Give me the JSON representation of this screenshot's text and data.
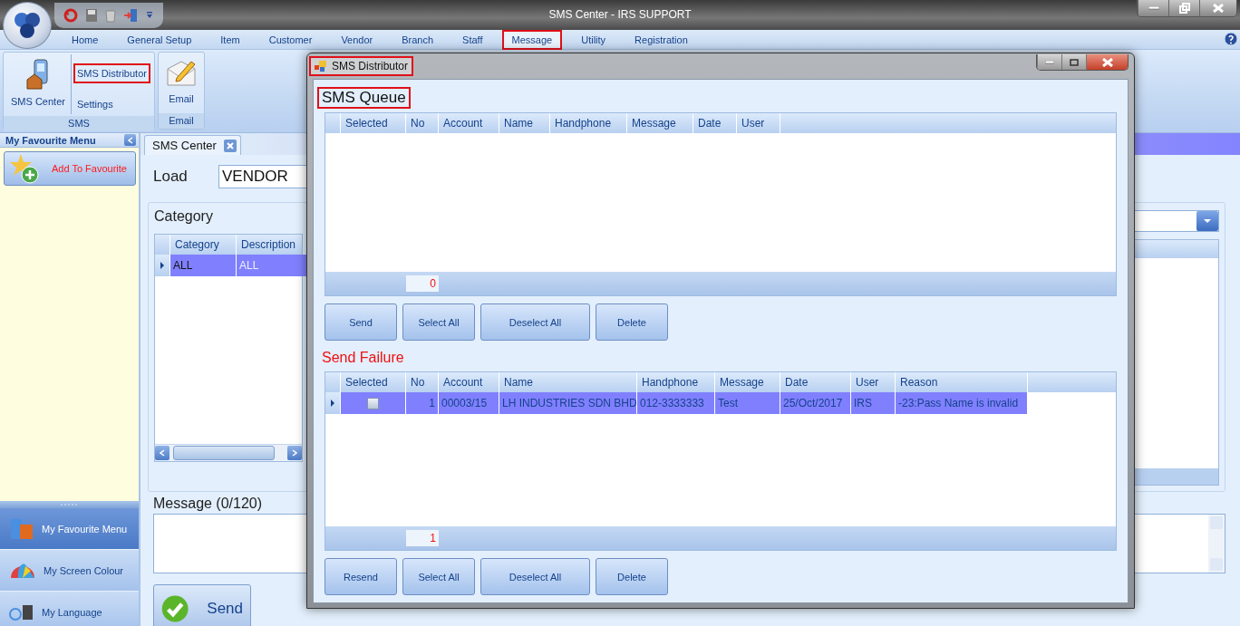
{
  "window": {
    "title": "SMS Center - IRS SUPPORT"
  },
  "menu": [
    {
      "label": "Home",
      "selected": false,
      "highlighted": false
    },
    {
      "label": "General Setup",
      "selected": false,
      "highlighted": false
    },
    {
      "label": "Item",
      "selected": false,
      "highlighted": false
    },
    {
      "label": "Customer",
      "selected": false,
      "highlighted": false
    },
    {
      "label": "Vendor",
      "selected": false,
      "highlighted": false
    },
    {
      "label": "Branch",
      "selected": false,
      "highlighted": false
    },
    {
      "label": "Staff",
      "selected": false,
      "highlighted": false
    },
    {
      "label": "Message",
      "selected": true,
      "highlighted": true
    },
    {
      "label": "Utility",
      "selected": false,
      "highlighted": false
    },
    {
      "label": "Registration",
      "selected": false,
      "highlighted": false
    }
  ],
  "ribbon": {
    "groups": [
      {
        "label": "SMS",
        "buttons": [
          {
            "kind": "large",
            "label": "SMS Center",
            "highlighted": false
          },
          {
            "kind": "small",
            "label": "SMS Distributor",
            "highlighted": true
          },
          {
            "kind": "small",
            "label": "Settings",
            "highlighted": false
          }
        ]
      },
      {
        "label": "Email",
        "buttons": [
          {
            "kind": "large",
            "label": "Email",
            "highlighted": false
          }
        ]
      }
    ]
  },
  "sidebar": {
    "title": "My Favourite Menu",
    "add_button": "Add To Favourite",
    "nav": [
      {
        "label": "My Favourite Menu",
        "selected": true
      },
      {
        "label": "My Screen Colour",
        "selected": false
      },
      {
        "label": "My Language",
        "selected": false
      }
    ]
  },
  "document_tab": {
    "label": "SMS Center"
  },
  "form": {
    "load_label": "Load",
    "load_value": "VENDOR",
    "category": {
      "title": "Category",
      "columns": [
        "Category",
        "Description"
      ],
      "rows": [
        {
          "cells": [
            "ALL",
            "ALL"
          ],
          "selected": true
        }
      ]
    },
    "message_label": "Message (0/120)",
    "send_button": "Send"
  },
  "dialog": {
    "title": "SMS Distributor",
    "title_highlighted": true,
    "queue": {
      "title": "SMS Queue",
      "highlighted": true,
      "columns": [
        "Selected",
        "No",
        "Account",
        "Name",
        "Handphone",
        "Message",
        "Date",
        "User"
      ],
      "count": "0",
      "buttons": [
        "Send",
        "Select All",
        "Deselect All",
        "Delete"
      ]
    },
    "failure": {
      "title": "Send Failure",
      "highlighted": false,
      "columns": [
        "Selected",
        "No",
        "Account",
        "Name",
        "Handphone",
        "Message",
        "Date",
        "User",
        "Reason"
      ],
      "rows": [
        {
          "selected": true,
          "checked": false,
          "cells": [
            "",
            "1",
            "00003/15",
            "LH INDUSTRIES SDN BHD",
            "012-3333333",
            "Test",
            "25/Oct/2017",
            "IRS",
            "-23:Pass Name is invalid"
          ]
        }
      ],
      "count": "1",
      "buttons": [
        "Resend",
        "Select All",
        "Deselect All",
        "Delete"
      ]
    }
  }
}
